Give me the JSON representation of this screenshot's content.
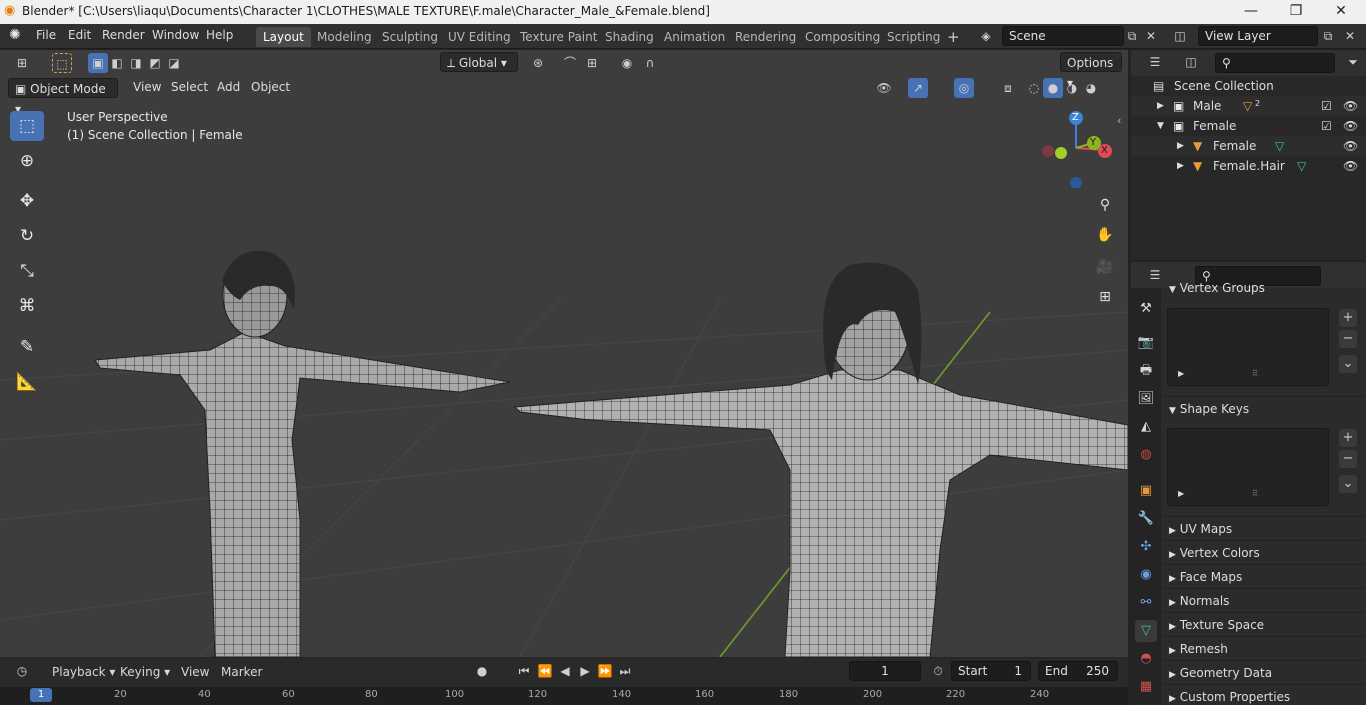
{
  "window": {
    "title": "Blender* [C:\\Users\\liaqu\\Documents\\Character 1\\CLOTHES\\MALE TEXTURE\\F.male\\Character_Male_&Female.blend]",
    "controls": {
      "min": "—",
      "max": "❐",
      "close": "✕"
    }
  },
  "menu": [
    "File",
    "Edit",
    "Render",
    "Window",
    "Help"
  ],
  "workspaces": [
    "Layout",
    "Modeling",
    "Sculpting",
    "UV Editing",
    "Texture Paint",
    "Shading",
    "Animation",
    "Rendering",
    "Compositing",
    "Scripting"
  ],
  "workspace_add": "+",
  "scene": {
    "value": "Scene"
  },
  "view_layer": {
    "value": "View Layer"
  },
  "header": {
    "orientation": "Global",
    "options": "Options"
  },
  "viewport": {
    "mode": "Object Mode",
    "menus": [
      "View",
      "Select",
      "Add",
      "Object"
    ],
    "perspective": "User Perspective",
    "collection_info": "(1) Scene Collection | Female",
    "gizmo": {
      "z": "Z",
      "y": "Y",
      "x": "X"
    }
  },
  "outliner": {
    "root": "Scene Collection",
    "items": [
      {
        "name": "Male",
        "badge": "2"
      },
      {
        "name": "Female"
      },
      {
        "name": "Female"
      },
      {
        "name": "Female.Hair"
      }
    ]
  },
  "properties": {
    "panels": {
      "vertex_groups": "Vertex Groups",
      "shape_keys": "Shape Keys",
      "uv_maps": "UV Maps",
      "vertex_colors": "Vertex Colors",
      "face_maps": "Face Maps",
      "normals": "Normals",
      "texture_space": "Texture Space",
      "remesh": "Remesh",
      "geometry_data": "Geometry Data",
      "custom_properties": "Custom Properties"
    }
  },
  "timeline": {
    "menus": [
      "Playback",
      "Keying",
      "View",
      "Marker"
    ],
    "current_frame": "1",
    "start_label": "Start",
    "start": "1",
    "end_label": "End",
    "end": "250",
    "ruler": [
      "1",
      "20",
      "40",
      "60",
      "80",
      "100",
      "120",
      "140",
      "160",
      "180",
      "200",
      "220",
      "240"
    ]
  },
  "colors": {
    "accent": "#4772b3",
    "x_axis": "#e04b57",
    "y_axis": "#8ab523",
    "z_axis": "#3d82d6",
    "object_orange": "#e89a3c",
    "mesh_green": "#40c888"
  }
}
